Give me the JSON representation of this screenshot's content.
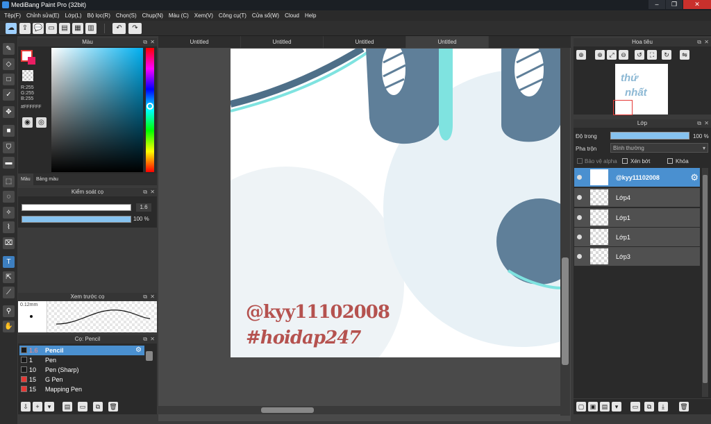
{
  "window": {
    "title": "MediBang Paint Pro (32bit)",
    "minimize": "–",
    "maximize": "❐",
    "close": "✕"
  },
  "menu": [
    "Tệp(F)",
    "Chỉnh sửa(E)",
    "Lớp(L)",
    "Bộ lọc(R)",
    "Chọn(S)",
    "Chụp(N)",
    "Màu (C)",
    "Xem(V)",
    "Công cụ(T)",
    "Cửa sổ(W)",
    "Cloud",
    "Help"
  ],
  "tabs": [
    "Untitled",
    "Untitled",
    "Untitled",
    "Untitled"
  ],
  "color_panel": {
    "title": "Màu",
    "r": "R:255",
    "g": "G:255",
    "b": "B:255",
    "hex": "#FFFFFF",
    "tab_color": "Màu",
    "tab_palette": "Bảng màu"
  },
  "brush_control": {
    "title": "Kiểm soát cọ",
    "size": "1.6",
    "opacity": "100 %",
    "opacity_value": 1.0
  },
  "brush_preview": {
    "title": "Xem trước cọ",
    "size_label": "0.12mm"
  },
  "brush_list": {
    "title": "Cọ: Pencil",
    "items": [
      {
        "size": "1.6",
        "name": "Pencil",
        "color": "#1a1a1a"
      },
      {
        "size": "1",
        "name": "Pen",
        "color": "#1a1a1a"
      },
      {
        "size": "10",
        "name": "Pen (Sharp)",
        "color": "#1a1a1a"
      },
      {
        "size": "15",
        "name": "G Pen",
        "color": "#e53935"
      },
      {
        "size": "15",
        "name": "Mapping Pen",
        "color": "#e53935"
      }
    ]
  },
  "navigator": {
    "title": "Hoa tiêu",
    "thumb_text_1": "thứ",
    "thumb_text_2": "nhất"
  },
  "layer_panel": {
    "title": "Lớp",
    "opacity_label": "Độ trong",
    "opacity_value": "100 %",
    "blend_label": "Pha trộn",
    "blend_value": "Bình thường",
    "protect_alpha": "Bảo vệ alpha",
    "clipping": "Xén bớt",
    "lock": "Khóa",
    "layers": [
      "@kyy11102008",
      "Lớp4",
      "Lớp1",
      "Lớp1",
      "Lớp3"
    ]
  },
  "canvas_text": {
    "line1": "@kyy11102008",
    "line2": "#hoidap247"
  },
  "colors": {
    "accent": "#4a90d0",
    "brand_red": "#e53935",
    "canvas_text": "#b5524f"
  }
}
